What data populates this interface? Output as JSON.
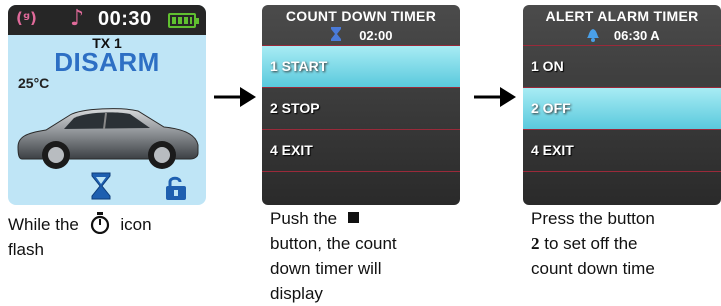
{
  "screen1": {
    "time": "00:30",
    "transmitter": "TX 1",
    "state": "DISARM",
    "temperature": "25°C",
    "colors": {
      "state": "#2d6fc4",
      "battery": "#60c030",
      "icons": "#e06a9a"
    }
  },
  "screen2": {
    "title": "COUNT DOWN TIMER",
    "timer_value": "02:00",
    "items": [
      {
        "label": "1  START",
        "highlighted": true
      },
      {
        "label": "2  STOP",
        "highlighted": false
      },
      {
        "label": "4  EXIT",
        "highlighted": false
      }
    ]
  },
  "screen3": {
    "title": "ALERT ALARM TIMER",
    "alarm_value": "06:30 A",
    "items": [
      {
        "label": "1  ON",
        "highlighted": false
      },
      {
        "label": "2  OFF",
        "highlighted": true
      },
      {
        "label": "4  EXIT",
        "highlighted": false
      }
    ]
  },
  "captions": {
    "c1_before": "While the",
    "c1_after": "icon",
    "c1_line2": "flash",
    "c2_line1": "Push the",
    "c2_line2": "button, the count",
    "c2_line3": "down timer will",
    "c2_line4": "display",
    "c3_line1": "Press the button",
    "c3_num": "2",
    "c3_line2_rest": " to set off the",
    "c3_line3": "count down time"
  }
}
